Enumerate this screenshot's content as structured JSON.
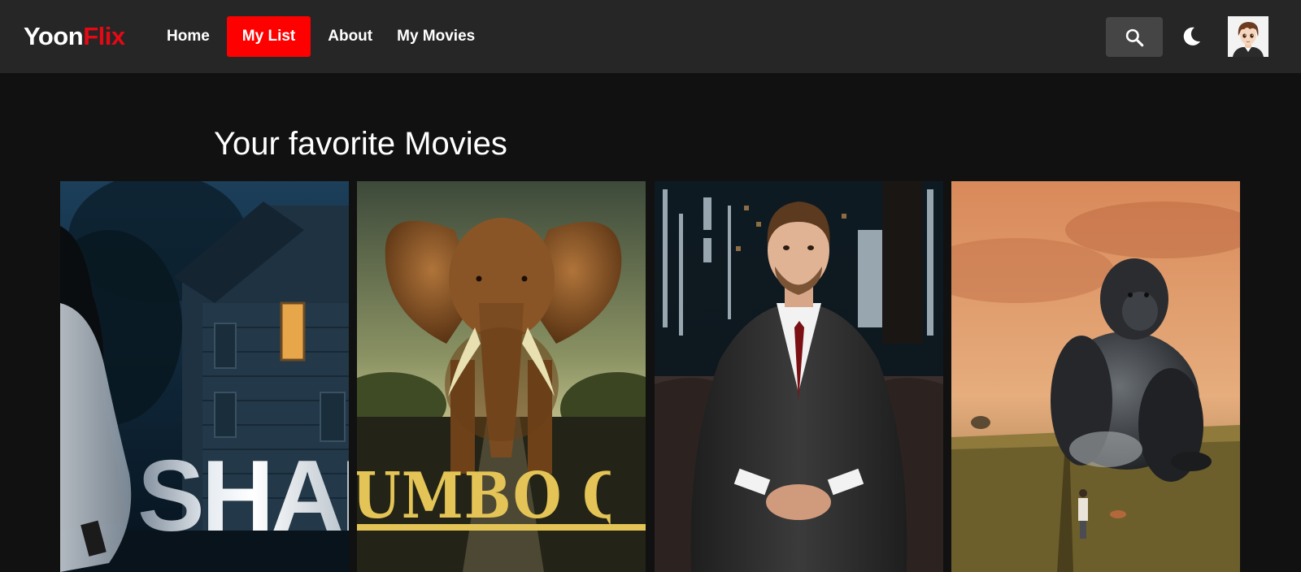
{
  "app": {
    "logo_part1": "Yoon",
    "logo_part2": "Flix",
    "colors": {
      "accent": "#e50914",
      "active_tab": "#ff0000",
      "navbar": "#262626",
      "background": "#111111"
    }
  },
  "nav": {
    "items": [
      {
        "label": "Home",
        "active": false
      },
      {
        "label": "My List",
        "active": true
      },
      {
        "label": "About",
        "active": false
      },
      {
        "label": "My Movies",
        "active": false
      }
    ]
  },
  "toolbar": {
    "search_icon": "search-icon",
    "theme_icon": "moon-icon",
    "avatar_icon": "anime-avatar"
  },
  "main": {
    "section_title": "Your favorite Movies",
    "posters": [
      {
        "title_text": "SHAD"
      },
      {
        "title_text": "UMBO QUEE"
      },
      {
        "title_text": ""
      },
      {
        "title_text": ""
      }
    ]
  }
}
